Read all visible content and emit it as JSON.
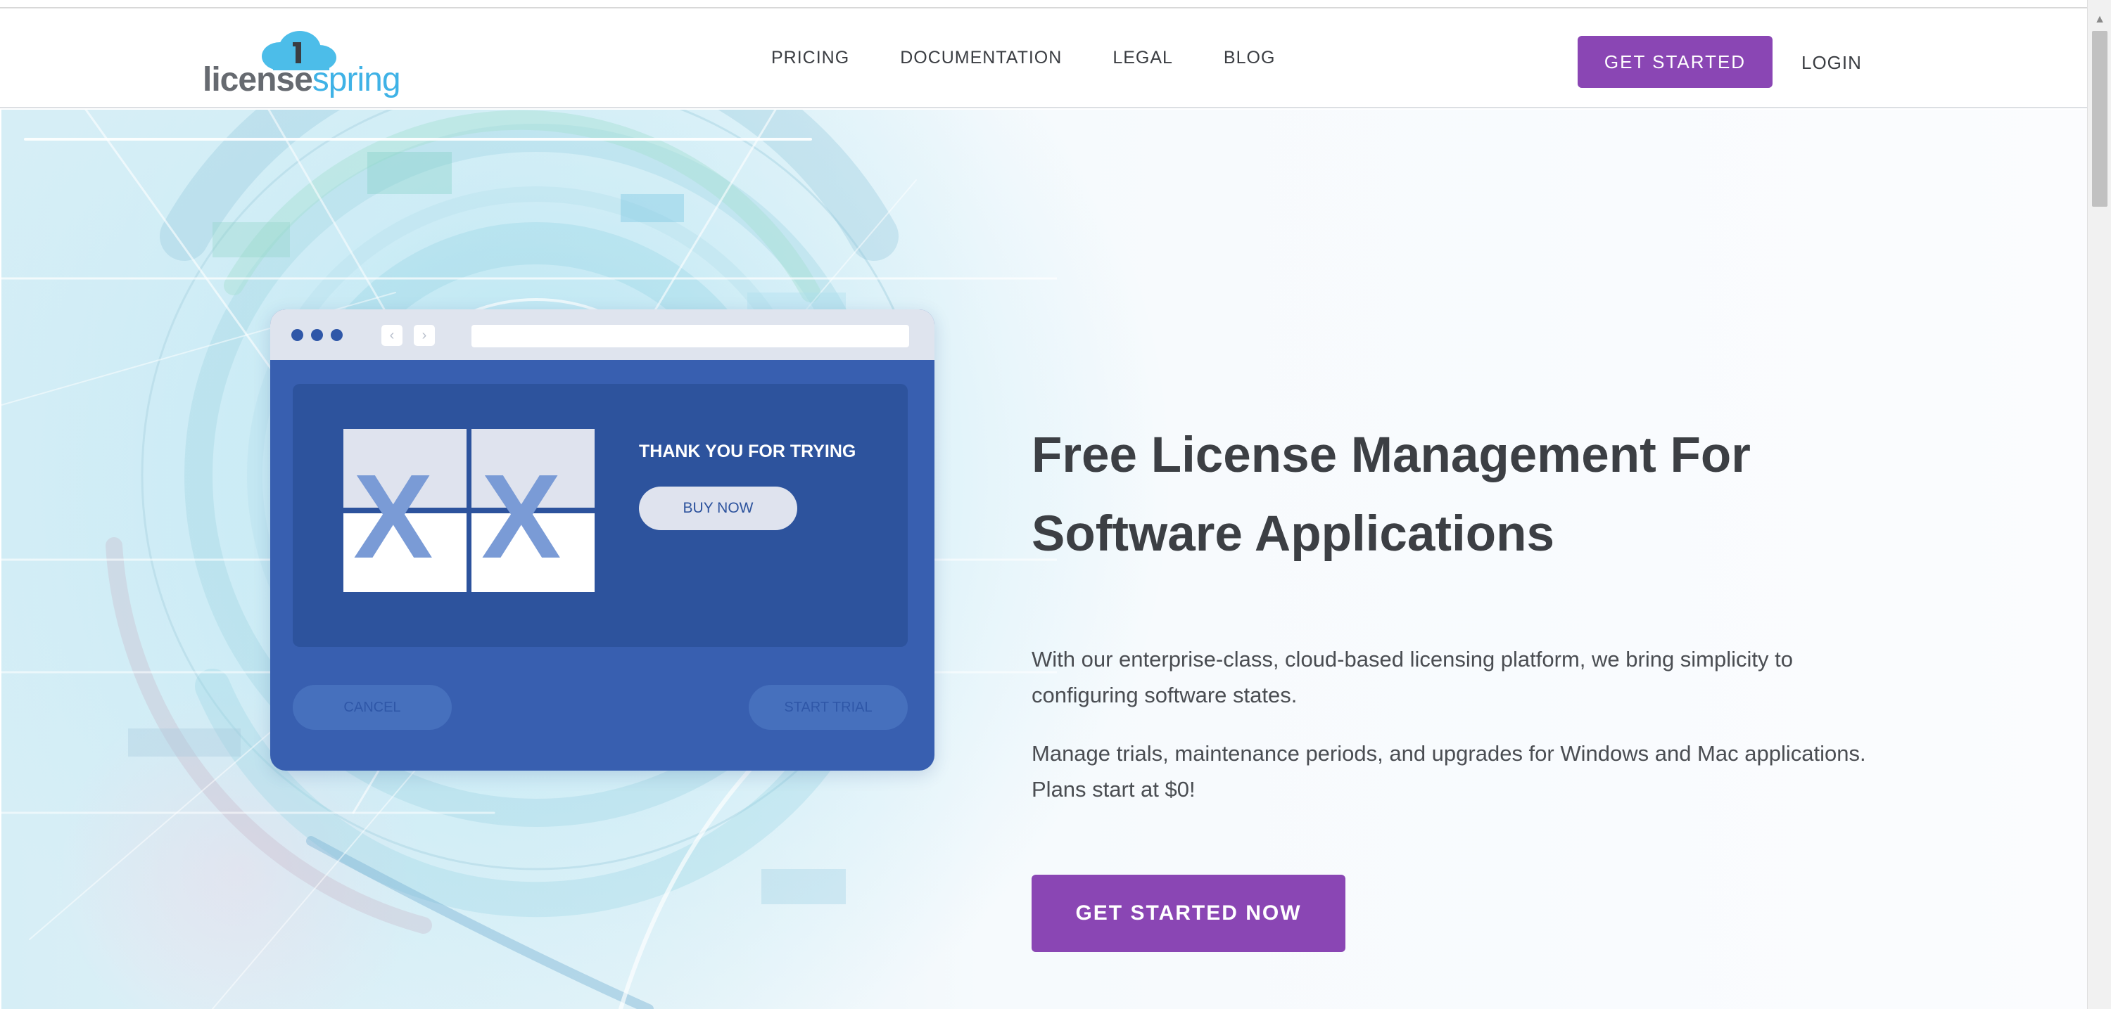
{
  "header": {
    "logo": {
      "part1": "license",
      "part2": "spring"
    },
    "nav": [
      {
        "label": "PRICING"
      },
      {
        "label": "DOCUMENTATION"
      },
      {
        "label": "LEGAL"
      },
      {
        "label": "BLOG"
      }
    ],
    "get_started_label": "GET STARTED",
    "login_label": "LOGIN"
  },
  "hero": {
    "title_line1": "Free License Management For",
    "title_line2": "Software Applications",
    "paragraph1": "With our enterprise-class, cloud-based licensing platform, we bring simplicity to configuring software states.",
    "paragraph2": "Manage trials, maintenance periods, and upgrades for Windows and Mac applications. Plans start at $0!",
    "cta_label": "GET STARTED NOW"
  },
  "mockup": {
    "nav_back": "‹",
    "nav_forward": "›",
    "tile_mark": "X",
    "thanks_text": "THANK YOU FOR TRYING",
    "buy_label": "BUY NOW",
    "cancel_label": "CANCEL",
    "start_trial_label": "START TRIAL"
  },
  "scrollbar": {
    "up_arrow": "▲"
  },
  "colors": {
    "brand_purple": "#8a46b4",
    "logo_blue": "#3fb2e6",
    "mockup_blue": "#385fb0",
    "text_dark": "#3c3f44"
  },
  "icons": [
    "cloud-logo-icon",
    "chevron-left-icon",
    "chevron-right-icon",
    "scroll-up-arrow-icon"
  ]
}
